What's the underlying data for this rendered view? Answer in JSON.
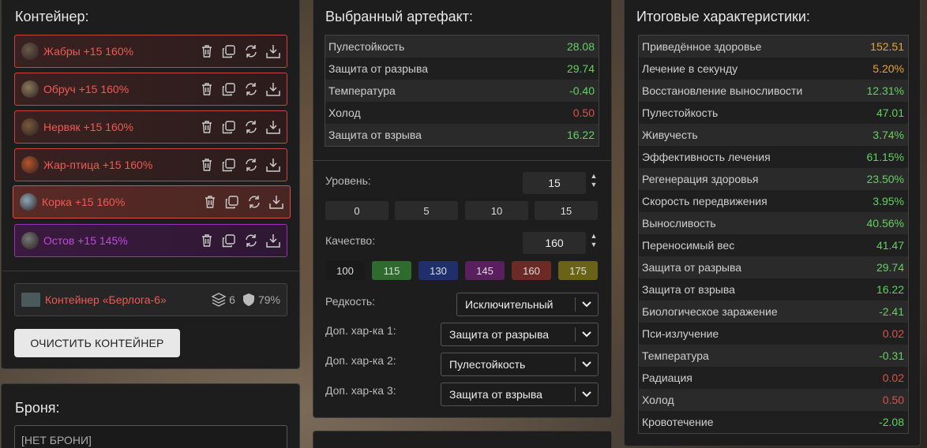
{
  "container": {
    "title": "Контейнер:",
    "items": [
      {
        "name": "Жабры +15 160%",
        "icon": "gills-artifact-icon",
        "thumb": "#6b5a4a"
      },
      {
        "name": "Обруч +15 160%",
        "icon": "hoop-artifact-icon",
        "thumb": "#8a7a5a"
      },
      {
        "name": "Нервяк +15 160%",
        "icon": "nerve-artifact-icon",
        "thumb": "#7a5a3a"
      },
      {
        "name": "Жар-птица +15 160%",
        "icon": "firebird-artifact-icon",
        "thumb": "#b8552a"
      },
      {
        "name": "Корка +15 160%",
        "icon": "crust-artifact-icon",
        "thumb": "#8fa8b8"
      },
      {
        "name": "Остов +15 145%",
        "icon": "skeleton-artifact-icon",
        "thumb": "#777"
      }
    ],
    "container_name": "Контейнер «Берлога-6»",
    "slots": "6",
    "protection": "79%",
    "clear_button": "ОЧИСТИТЬ КОНТЕЙНЕР"
  },
  "armor": {
    "title": "Броня:",
    "value": "[НЕТ БРОНИ]"
  },
  "artifact": {
    "title": "Выбранный артефакт:",
    "stats": [
      {
        "label": "Пулестойкость",
        "value": "28.08",
        "color": "green"
      },
      {
        "label": "Защита от разрыва",
        "value": "29.74",
        "color": "green"
      },
      {
        "label": "Температура",
        "value": "-0.40",
        "color": "green"
      },
      {
        "label": "Холод",
        "value": "0.50",
        "color": "red"
      },
      {
        "label": "Защита от взрыва",
        "value": "16.22",
        "color": "green"
      }
    ],
    "level_label": "Уровень:",
    "level_value": "15",
    "level_presets": [
      "0",
      "5",
      "10",
      "15"
    ],
    "quality_label": "Качество:",
    "quality_value": "160",
    "quality_presets": [
      {
        "label": "100",
        "color": "#1a1a1a"
      },
      {
        "label": "115",
        "color": "#2f6b2f"
      },
      {
        "label": "130",
        "color": "#1f2f6b"
      },
      {
        "label": "145",
        "color": "#5a1f5e"
      },
      {
        "label": "160",
        "color": "#6b2a26"
      },
      {
        "label": "175",
        "color": "#6b621a"
      }
    ],
    "rarity_label": "Редкость:",
    "rarity_value": "Исключительный",
    "extra1_label": "Доп. хар-ка 1:",
    "extra1_value": "Защита от разрыва",
    "extra2_label": "Доп. хар-ка 2:",
    "extra2_value": "Пулестойкость",
    "extra3_label": "Доп. хар-ка 3:",
    "extra3_value": "Защита от взрыва"
  },
  "totals": {
    "title": "Итоговые характеристики:",
    "stats": [
      {
        "label": "Приведённое здоровье",
        "value": "152.51",
        "color": "orange"
      },
      {
        "label": "Лечение в секунду",
        "value": "5.20%",
        "color": "orange"
      },
      {
        "label": "Восстановление выносливости",
        "value": "12.31%",
        "color": "green"
      },
      {
        "label": "Пулестойкость",
        "value": "47.01",
        "color": "green"
      },
      {
        "label": "Живучесть",
        "value": "3.74%",
        "color": "green"
      },
      {
        "label": "Эффективность лечения",
        "value": "61.15%",
        "color": "green"
      },
      {
        "label": "Регенерация здоровья",
        "value": "23.50%",
        "color": "green"
      },
      {
        "label": "Скорость передвижения",
        "value": "3.95%",
        "color": "green"
      },
      {
        "label": "Выносливость",
        "value": "40.56%",
        "color": "green"
      },
      {
        "label": "Переносимый вес",
        "value": "41.47",
        "color": "green"
      },
      {
        "label": "Защита от разрыва",
        "value": "29.74",
        "color": "green"
      },
      {
        "label": "Защита от взрыва",
        "value": "16.22",
        "color": "green"
      },
      {
        "label": "Биологическое заражение",
        "value": "-2.41",
        "color": "green"
      },
      {
        "label": "Пси-излучение",
        "value": "0.02",
        "color": "red"
      },
      {
        "label": "Температура",
        "value": "-0.31",
        "color": "green"
      },
      {
        "label": "Радиация",
        "value": "0.02",
        "color": "red"
      },
      {
        "label": "Холод",
        "value": "0.50",
        "color": "red"
      },
      {
        "label": "Кровотечение",
        "value": "-2.08",
        "color": "green"
      }
    ]
  }
}
